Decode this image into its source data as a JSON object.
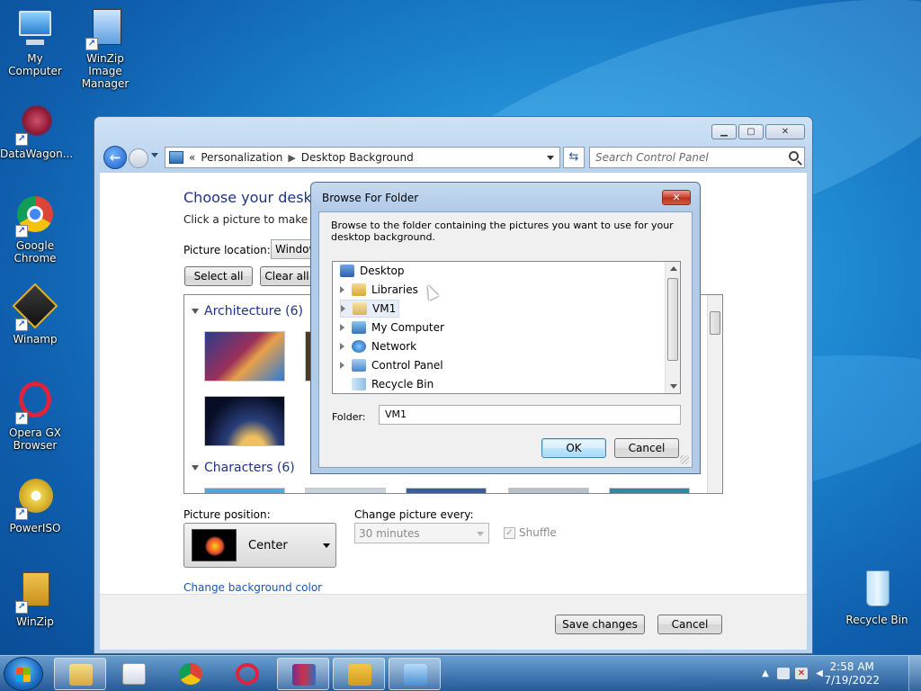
{
  "desktop": {
    "icons": [
      {
        "label": "My Computer"
      },
      {
        "label": "WinZip Image Manager"
      },
      {
        "label": "DataWagon..."
      },
      {
        "label": "Google Chrome"
      },
      {
        "label": "Winamp"
      },
      {
        "label": "Opera GX Browser"
      },
      {
        "label": "PowerISO"
      },
      {
        "label": "WinZip"
      },
      {
        "label": "Recycle Bin"
      }
    ]
  },
  "control_panel": {
    "breadcrumb": {
      "prefix": "«",
      "items": [
        "Personalization",
        "Desktop Background"
      ]
    },
    "search_placeholder": "Search Control Panel",
    "heading": "Choose your desktop",
    "subtitle": "Click a picture to make it y",
    "picture_location_label": "Picture location:",
    "picture_location_value": "Window",
    "select_all": "Select all",
    "clear_all": "Clear all",
    "groups": [
      {
        "label": "Architecture (6)"
      },
      {
        "label": "Characters (6)"
      }
    ],
    "picture_position_label": "Picture position:",
    "picture_position_value": "Center",
    "change_every_label": "Change picture every:",
    "change_every_value": "30 minutes",
    "shuffle_label": "Shuffle",
    "bg_color_link": "Change background color",
    "save_changes": "Save changes",
    "cancel": "Cancel"
  },
  "dialog": {
    "title": "Browse For Folder",
    "close_glyph": "✕",
    "description": "Browse to the folder containing the pictures you want to use for your desktop background.",
    "tree": [
      {
        "label": "Desktop",
        "selected": false
      },
      {
        "label": "Libraries",
        "selected": false
      },
      {
        "label": "VM1",
        "selected": true
      },
      {
        "label": "My Computer",
        "selected": false
      },
      {
        "label": "Network",
        "selected": false
      },
      {
        "label": "Control Panel",
        "selected": false
      },
      {
        "label": "Recycle Bin",
        "selected": false
      }
    ],
    "folder_label": "Folder:",
    "folder_value": "VM1",
    "ok": "OK",
    "cancel": "Cancel"
  },
  "taskbar": {
    "clock_time": "2:58 AM",
    "clock_date": "7/19/2022"
  },
  "colors": {
    "link": "#1a55b5",
    "heading": "#1e3287",
    "close_red": "#c9432b"
  }
}
